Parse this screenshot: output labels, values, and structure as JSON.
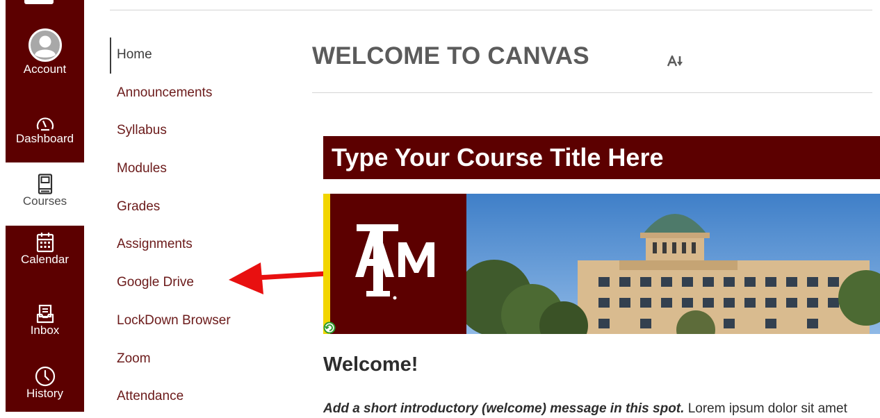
{
  "global_nav": {
    "items": [
      {
        "label": "Account",
        "icon": "account-avatar-icon"
      },
      {
        "label": "Dashboard",
        "icon": "dashboard-gauge-icon"
      },
      {
        "label": "Courses",
        "icon": "courses-book-icon"
      },
      {
        "label": "Calendar",
        "icon": "calendar-icon"
      },
      {
        "label": "Inbox",
        "icon": "inbox-icon"
      },
      {
        "label": "History",
        "icon": "history-clock-icon"
      }
    ]
  },
  "course_nav": {
    "items": [
      {
        "label": "Home",
        "active": true
      },
      {
        "label": "Announcements"
      },
      {
        "label": "Syllabus"
      },
      {
        "label": "Modules"
      },
      {
        "label": "Grades"
      },
      {
        "label": "Assignments"
      },
      {
        "label": "Google Drive"
      },
      {
        "label": "LockDown Browser"
      },
      {
        "label": "Zoom"
      },
      {
        "label": "Attendance"
      }
    ]
  },
  "page": {
    "title": "WELCOME TO CANVAS",
    "course_title": "Type Your Course Title Here",
    "welcome_heading": "Welcome!",
    "intro_emphasis": "Add a short introductory (welcome) message in this spot.",
    "intro_text": " Lorem ipsum dolor sit amet"
  },
  "colors": {
    "maroon": "#5c0000",
    "accent_yellow": "#f2d500",
    "arrow_red": "#e81010"
  }
}
